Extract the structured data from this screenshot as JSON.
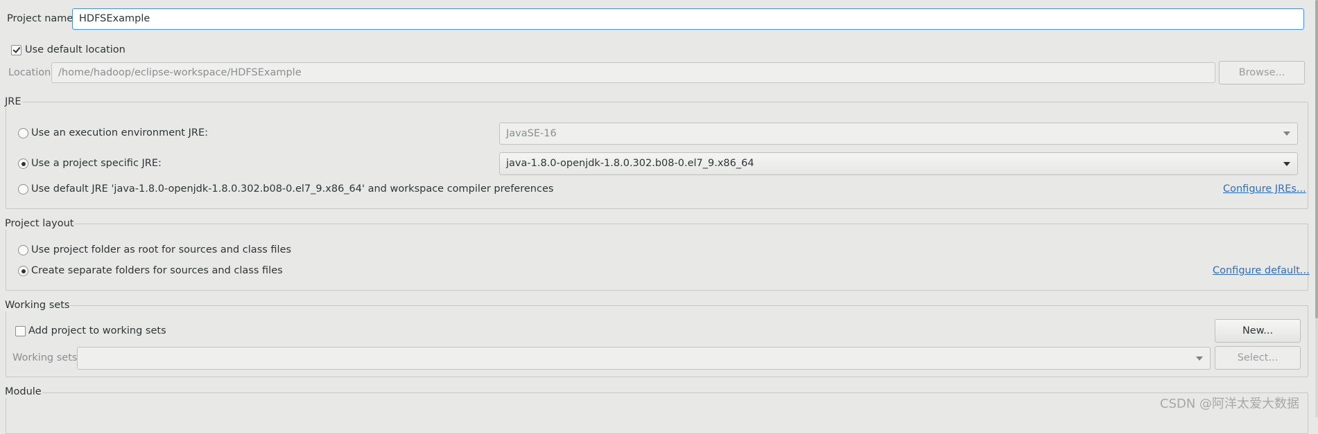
{
  "project": {
    "name_label": "Project name:",
    "name_value": "HDFSExample",
    "use_default_location_label": "Use default location",
    "use_default_location_checked": true,
    "location_label": "Location:",
    "location_value": "/home/hadoop/eclipse-workspace/HDFSExample",
    "browse_label": "Browse..."
  },
  "jre": {
    "title": "JRE",
    "exec_env_label": "Use an execution environment JRE:",
    "exec_env_value": "JavaSE-16",
    "project_specific_label": "Use a project specific JRE:",
    "project_specific_value": "java-1.8.0-openjdk-1.8.0.302.b08-0.el7_9.x86_64",
    "default_jre_label": "Use default JRE 'java-1.8.0-openjdk-1.8.0.302.b08-0.el7_9.x86_64' and workspace compiler preferences",
    "configure_link": "Configure JREs...",
    "selected": "project_specific"
  },
  "layout": {
    "title": "Project layout",
    "root_option": "Use project folder as root for sources and class files",
    "separate_option": "Create separate folders for sources and class files",
    "configure_link": "Configure default...",
    "selected": "separate"
  },
  "working_sets": {
    "title": "Working sets",
    "add_label": "Add project to working sets",
    "add_checked": false,
    "new_button": "New...",
    "sets_label": "Working sets:",
    "sets_value": "",
    "select_button": "Select..."
  },
  "module": {
    "title": "Module"
  },
  "watermark": "CSDN @阿洋太爱大数据",
  "colors": {
    "background": "#e8e8e7",
    "focus_border": "#4a90d9",
    "link": "#2a6fc9"
  }
}
